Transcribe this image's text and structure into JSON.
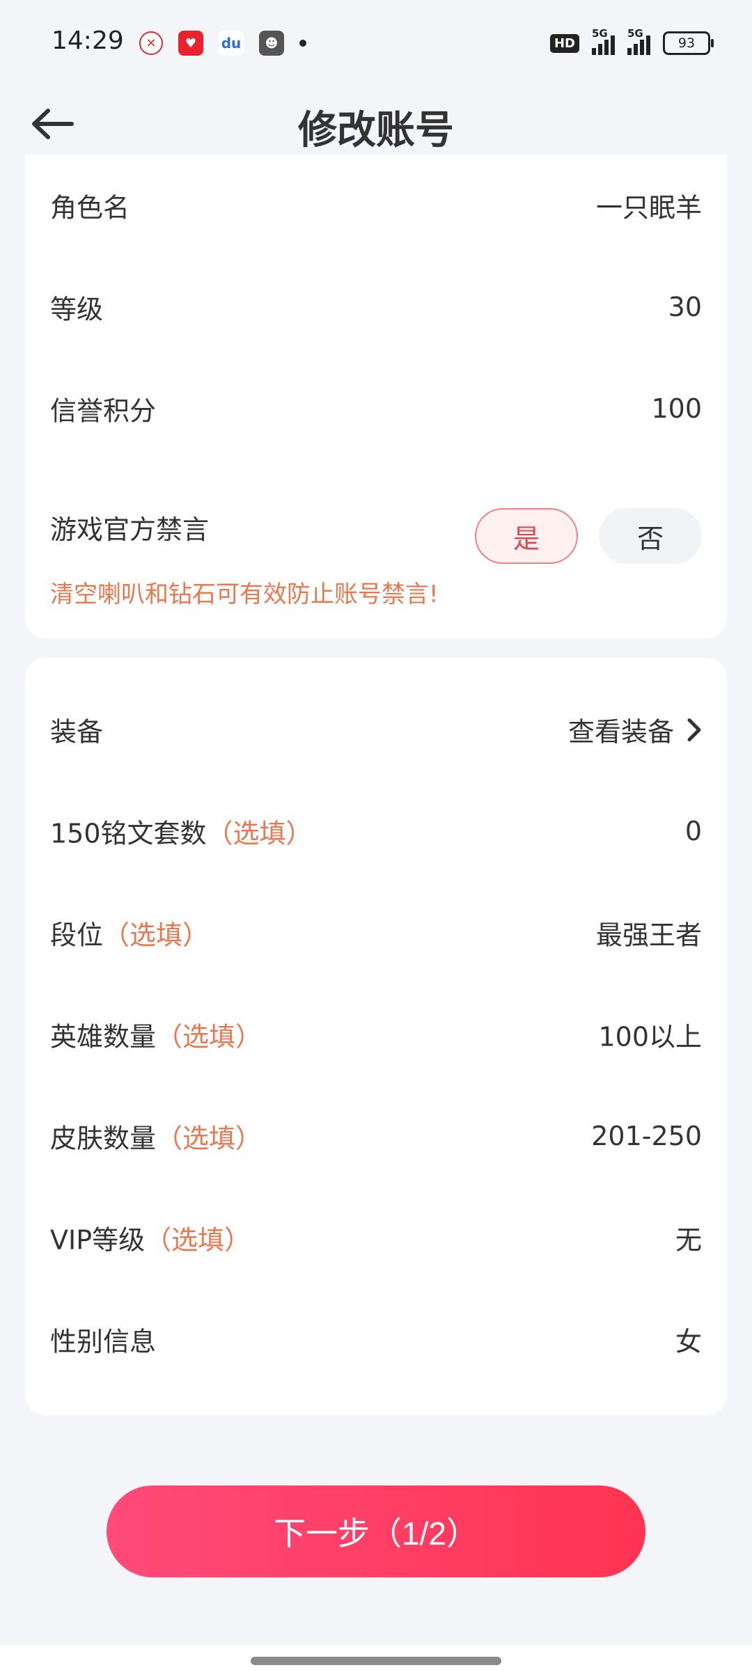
{
  "status_bar": {
    "time": "14:29",
    "network_hd": "HD",
    "signal1_label": "5G",
    "signal2_label": "5G",
    "battery": "93"
  },
  "header": {
    "title": "修改账号"
  },
  "card1": {
    "rows": [
      {
        "label": "角色名",
        "value": "一只眠羊"
      },
      {
        "label": "等级",
        "value": "30"
      },
      {
        "label": "信誉积分",
        "value": "100"
      }
    ],
    "ban": {
      "label": "游戏官方禁言",
      "yes": "是",
      "no": "否",
      "selected": "yes",
      "warning": "清空喇叭和钻石可有效防止账号禁言!"
    }
  },
  "card2": {
    "equipment": {
      "label": "装备",
      "value": "查看装备"
    },
    "rows": [
      {
        "label": "150铭文套数",
        "optional": "（选填）",
        "value": "0"
      },
      {
        "label": "段位",
        "optional": "（选填）",
        "value": "最强王者"
      },
      {
        "label": "英雄数量",
        "optional": "（选填）",
        "value": "100以上"
      },
      {
        "label": "皮肤数量",
        "optional": "（选填）",
        "value": "201-250"
      },
      {
        "label": "VIP等级",
        "optional": "（选填）",
        "value": "无"
      },
      {
        "label": "性别信息",
        "optional": "",
        "value": "女"
      }
    ]
  },
  "footer": {
    "next_button": "下一步（1/2）"
  },
  "colors": {
    "accent": "#ff3a5e",
    "optional_text": "#e8784f",
    "background": "#f3f5f9"
  }
}
